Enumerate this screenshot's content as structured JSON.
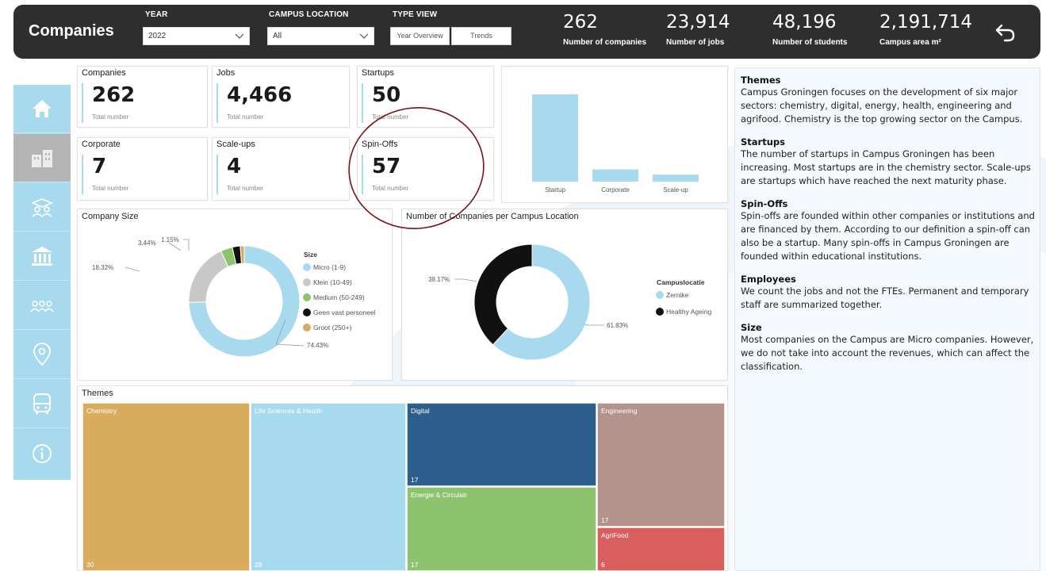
{
  "header": {
    "title": "Companies",
    "year": {
      "label": "YEAR",
      "value": "2022"
    },
    "campus_location": {
      "label": "CAMPUS LOCATION",
      "value": "All"
    },
    "type_view": {
      "label": "TYPE VIEW",
      "options": [
        "Year Overview",
        "Trends"
      ]
    },
    "kpis": [
      {
        "value": "262",
        "label": "Number of companies"
      },
      {
        "value": "23,914",
        "label": "Number of jobs"
      },
      {
        "value": "48,196",
        "label": "Number of students"
      },
      {
        "value": "2,191,714",
        "label": "Campus area m²"
      }
    ],
    "back_icon": "back-arrow-icon"
  },
  "sidebar": {
    "items": [
      {
        "icon": "home-icon",
        "active": false
      },
      {
        "icon": "companies-icon",
        "active": true
      },
      {
        "icon": "students-icon",
        "active": false
      },
      {
        "icon": "institution-icon",
        "active": false
      },
      {
        "icon": "people-icon",
        "active": false
      },
      {
        "icon": "location-pin-icon",
        "active": false
      },
      {
        "icon": "bus-icon",
        "active": false
      },
      {
        "icon": "info-icon",
        "active": false
      }
    ]
  },
  "cards": [
    {
      "title": "Companies",
      "value": "262",
      "sub": "Total number"
    },
    {
      "title": "Jobs",
      "value": "4,466",
      "sub": "Total number"
    },
    {
      "title": "Startups",
      "value": "50",
      "sub": "Total number"
    },
    {
      "title": "Corporate",
      "value": "7",
      "sub": "Total number"
    },
    {
      "title": "Scale-ups",
      "value": "4",
      "sub": "Total number"
    },
    {
      "title": "Spin-Offs",
      "value": "57",
      "sub": "Total number"
    }
  ],
  "annotation_color": "#7a1414",
  "colors": {
    "accent": "#a8daef",
    "header_bg": "#2e2e2e"
  },
  "chart_data": [
    {
      "type": "bar",
      "categories": [
        "Startup",
        "Corporate",
        "Scale-up"
      ],
      "values": [
        50,
        7,
        4
      ],
      "color": "#a8daef"
    },
    {
      "type": "pie",
      "title": "Company Size",
      "legend_title": "Size",
      "legend_position": "right",
      "donut": true,
      "labels": [
        "Micro (1-9)",
        "Klein (10-49)",
        "Medium (50-249)",
        "Geen vast personeel",
        "Groot (250+)"
      ],
      "values": [
        74.43,
        18.32,
        3.44,
        2.29,
        1.15
      ],
      "colors": [
        "#a8daef",
        "#c8c8c8",
        "#8ec36e",
        "#111111",
        "#d7aa5c"
      ],
      "data_labels": [
        "74.43%",
        "18.32%",
        "3.44%",
        "",
        "1.15%"
      ]
    },
    {
      "type": "pie",
      "title": "Number of Companies per Campus Location",
      "legend_title": "Campuslocatie",
      "legend_position": "right",
      "donut": true,
      "labels": [
        "Zernike",
        "Healthy Ageing"
      ],
      "values": [
        61.83,
        38.17
      ],
      "colors": [
        "#a8daef",
        "#111111"
      ],
      "data_labels": [
        "61.83%",
        "38.17%"
      ]
    },
    {
      "type": "treemap",
      "title": "Themes",
      "labels": [
        "Chemistry",
        "Life Sciences & Health",
        "Digital",
        "Energie & Circulair",
        "Engineering",
        "AgriFood"
      ],
      "values": [
        30,
        28,
        17,
        17,
        17,
        6
      ],
      "colors": [
        "#d9ab5c",
        "#a8daef",
        "#2d5f8c",
        "#8ec36e",
        "#b3938c",
        "#d95f5f"
      ]
    }
  ],
  "text_panel": [
    {
      "heading": "Themes",
      "body": "Campus Groningen focuses on the development of six major sectors: chemistry, digital, energy, health, engineering and agrifood. Chemistry is the top growing sector on the Campus."
    },
    {
      "heading": "Startups",
      "body": "The number of startups in Campus Groningen has been increasing. Most startups are in the chemistry sector. Scale-ups are startups which have reached the next maturity phase."
    },
    {
      "heading": "Spin-Offs",
      "body": "Spin-offs are founded within other companies or institutions and are financed by them. According to our definition a spin-off can also be a startup. Many spin-offs in Campus Groningen are founded within educational institutions."
    },
    {
      "heading": "Employees",
      "body": "We count the jobs and not the FTEs. Permanent and temporary staff are summarized together."
    },
    {
      "heading": "Size",
      "body": "Most companies on the Campus are Micro companies. However, we do not take into account the revenues, which can affect the classification."
    }
  ]
}
